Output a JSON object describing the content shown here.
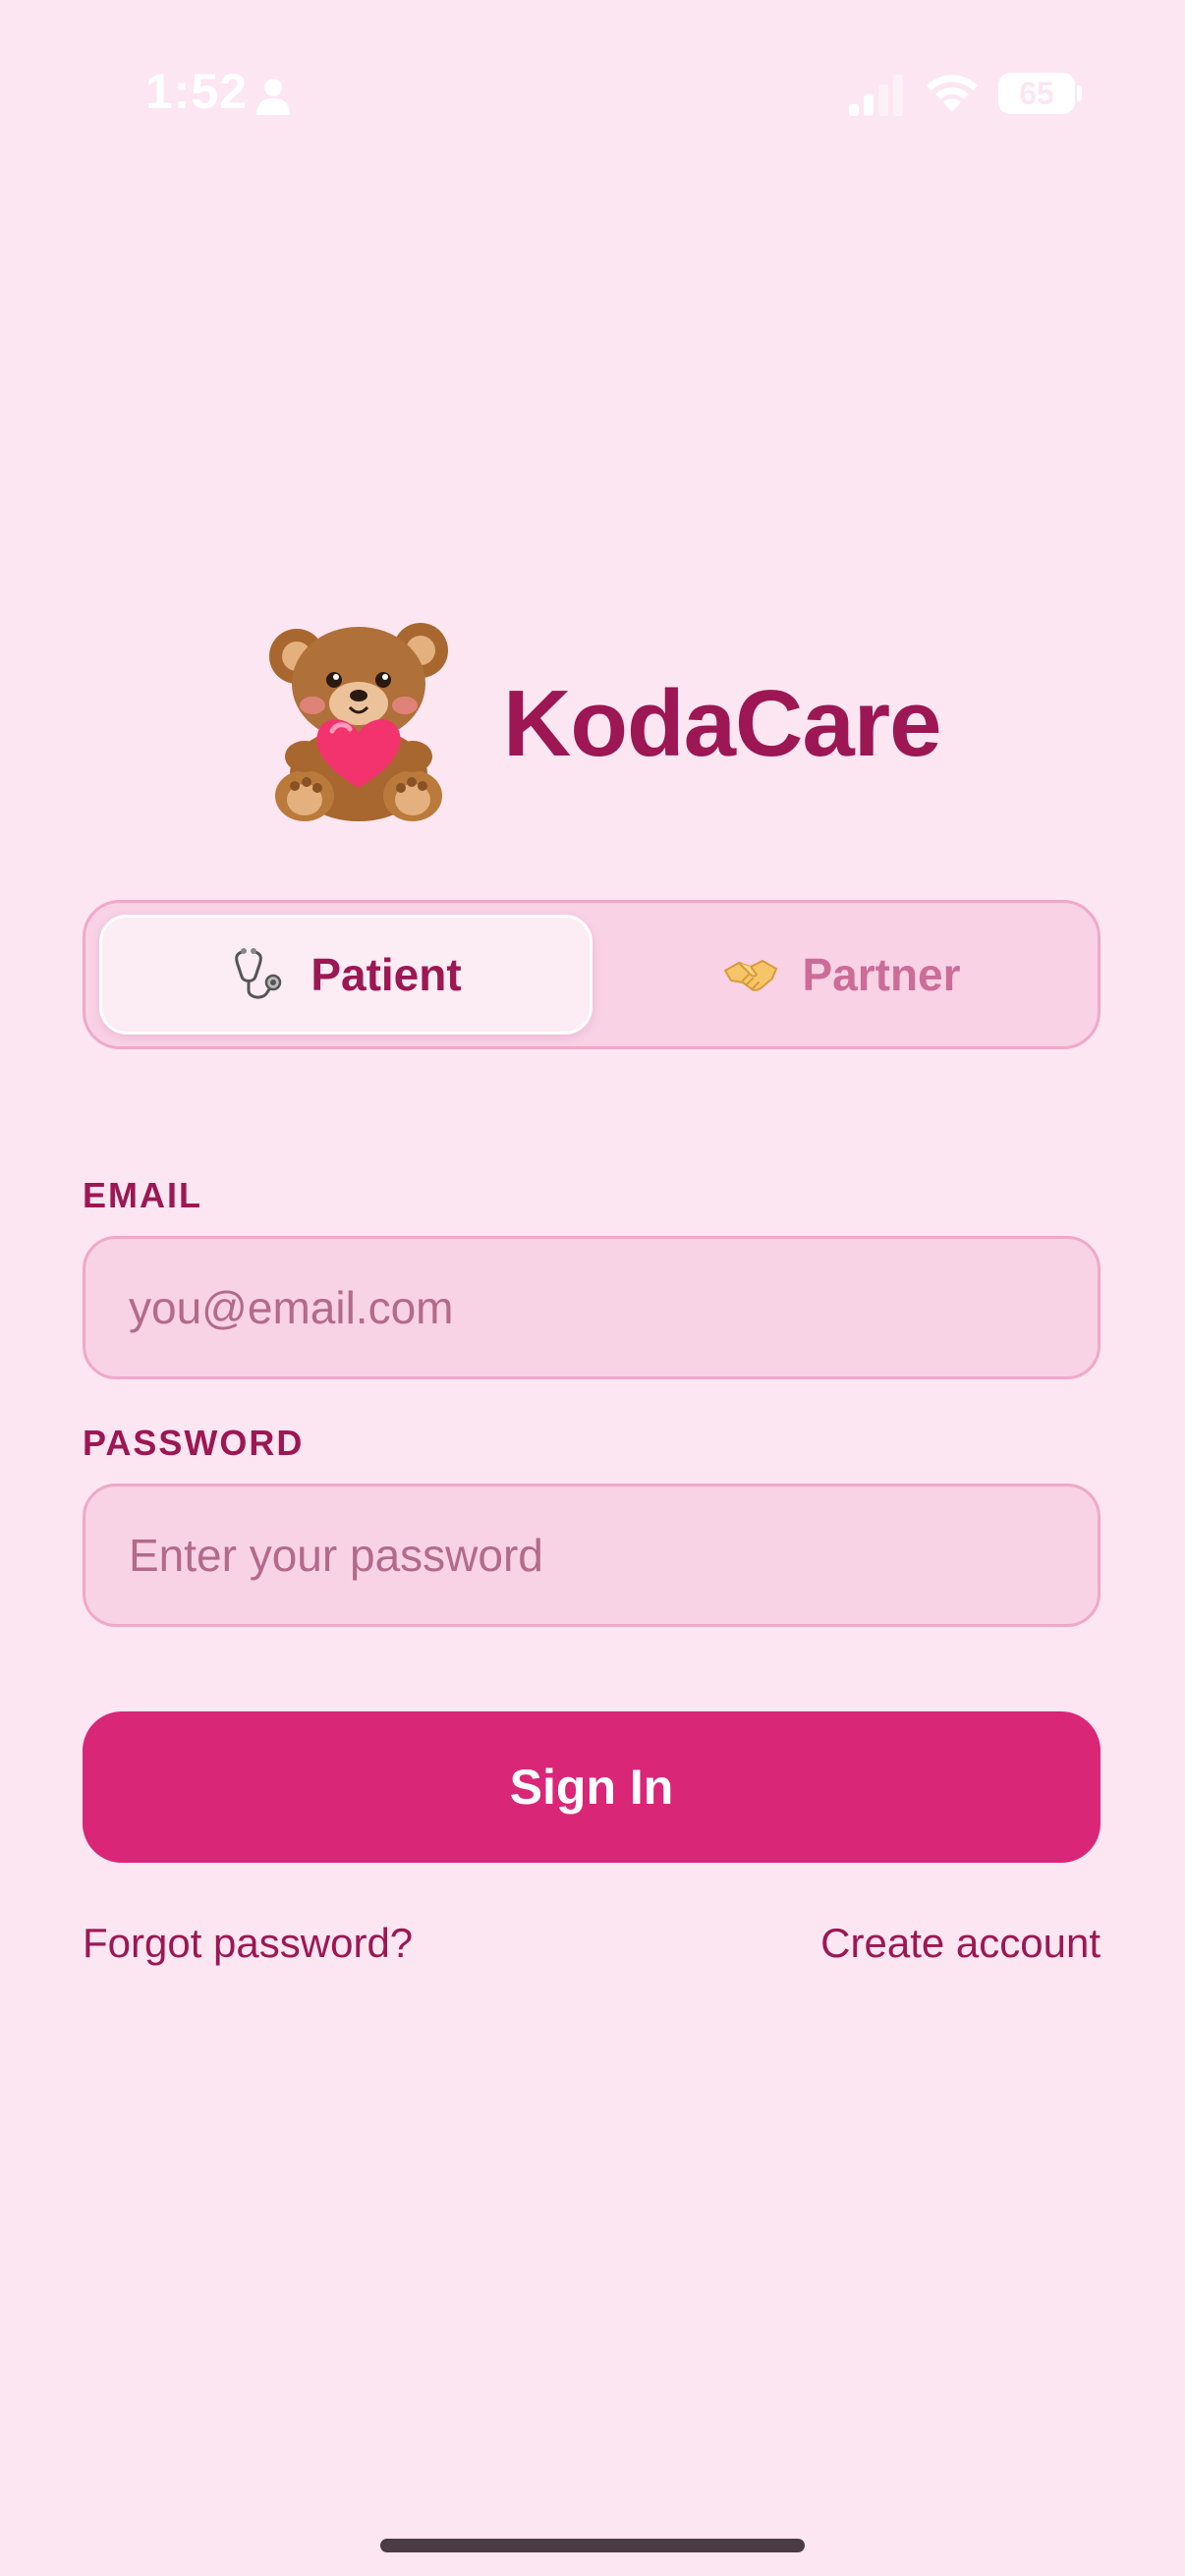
{
  "status_bar": {
    "time": "1:52",
    "battery": "65",
    "icons": [
      "person-icon",
      "cellular-signal-icon",
      "wifi-icon",
      "battery-icon"
    ]
  },
  "brand": {
    "logo_icon": "teddy-bear-with-heart",
    "title": "KodaCare"
  },
  "role_toggle": {
    "selected": "Patient",
    "options": [
      {
        "label": "Patient",
        "icon": "stethoscope-icon"
      },
      {
        "label": "Partner",
        "icon": "handshake-icon"
      }
    ]
  },
  "form": {
    "email_label": "EMAIL",
    "email_placeholder": "you@email.com",
    "email_value": "",
    "password_label": "PASSWORD",
    "password_placeholder": "Enter your password",
    "password_value": "",
    "submit_label": "Sign In"
  },
  "links": {
    "forgot_password": "Forgot password?",
    "create_account": "Create account"
  },
  "colors": {
    "background": "#fce6f2",
    "brand": "#9c1753",
    "accent": "#d92677",
    "field_fill": "#f8d3e5",
    "field_border": "#f0a8c9"
  }
}
